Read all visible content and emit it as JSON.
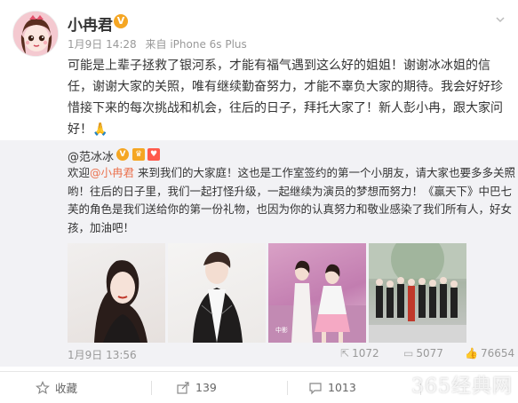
{
  "post": {
    "username": "小冉君",
    "verified_mark": "V",
    "date": "1月9日 14:28",
    "source": "来自 iPhone 6s Plus",
    "dropdown_icon": "chevron-down-icon",
    "text": "可能是上辈子拯救了银河系，才能有福气遇到这么好的姐姐！谢谢冰冰姐的信任，谢谢大家的关照，唯有继续勤奋努力，才能不辜负大家的期待。我会好好珍惜接下来的每次挑战和机会，往后的日子，拜托大家了！新人彭小冉，跟大家问好！",
    "emoji": "🙏"
  },
  "repost": {
    "author": "@范冰冰",
    "text_before": "欢迎",
    "mention": "@小冉君",
    "text_after": " 来到我们的大家庭！这也是工作室签约的第一个小朋友，请大家也要多多关照哟！往后的日子里，我们一起打怪升级，一起继续为演员的梦想而努力！《赢天下》中巴七芙的角色是我们送给你的第一份礼物，也因为你的认真努力和敬业感染了我们所有人，好女孩，加油吧！",
    "date": "1月9日 13:56",
    "reposts": "1072",
    "comments": "5077",
    "likes": "76654"
  },
  "actions": {
    "favorite": "收藏",
    "repost_count": "139",
    "comment_count": "1013"
  },
  "watermark": "365经典网",
  "colors": {
    "accent": "#eb7350",
    "badge": "#f5a623",
    "repost_bg": "#f2f2f5"
  }
}
